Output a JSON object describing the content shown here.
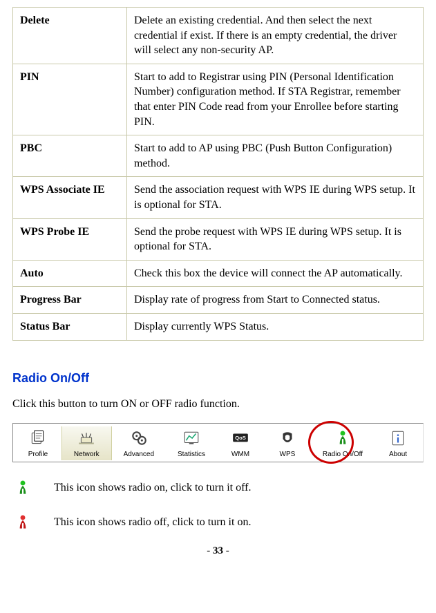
{
  "table": {
    "rows": [
      {
        "term": "Delete",
        "desc": "Delete an existing credential. And then select the next credential if exist. If there is an empty credential, the driver will select any non-security AP."
      },
      {
        "term": "PIN",
        "desc": "Start to add to Registrar using PIN (Personal Identification Number) configuration method. If STA Registrar, remember that enter PIN Code read from your Enrollee before starting PIN."
      },
      {
        "term": "PBC",
        "desc": "Start to add to AP using PBC (Push Button Configuration) method."
      },
      {
        "term": "WPS Associate IE",
        "desc": "Send the association request with WPS IE during WPS setup. It is optional for STA."
      },
      {
        "term": "WPS Probe IE",
        "desc": "Send the probe request with WPS IE during WPS setup. It is optional for STA."
      },
      {
        "term": "Auto",
        "desc": "Check this box the device will connect the AP automatically."
      },
      {
        "term": "Progress Bar",
        "desc": "Display rate of progress from Start to Connected status."
      },
      {
        "term": "Status Bar",
        "desc": "Display currently WPS Status."
      }
    ]
  },
  "section_heading": "Radio On/Off",
  "intro_text": "Click this button to turn ON or OFF radio function.",
  "toolbar": {
    "items": [
      {
        "label": "Profile",
        "icon": "profile"
      },
      {
        "label": "Network",
        "icon": "network",
        "selected": true
      },
      {
        "label": "Advanced",
        "icon": "advanced"
      },
      {
        "label": "Statistics",
        "icon": "statistics"
      },
      {
        "label": "WMM",
        "icon": "wmm"
      },
      {
        "label": "WPS",
        "icon": "wps"
      },
      {
        "label": "Radio On/Off",
        "icon": "radio-on",
        "circled": true
      },
      {
        "label": "About",
        "icon": "about"
      }
    ]
  },
  "legend": [
    {
      "icon": "radio-on",
      "text": "This icon shows radio on, click to turn it off."
    },
    {
      "icon": "radio-off",
      "text": "This icon shows radio off, click to turn it on."
    }
  ],
  "page": {
    "prefix": "- ",
    "number": "33",
    "suffix": " -"
  }
}
